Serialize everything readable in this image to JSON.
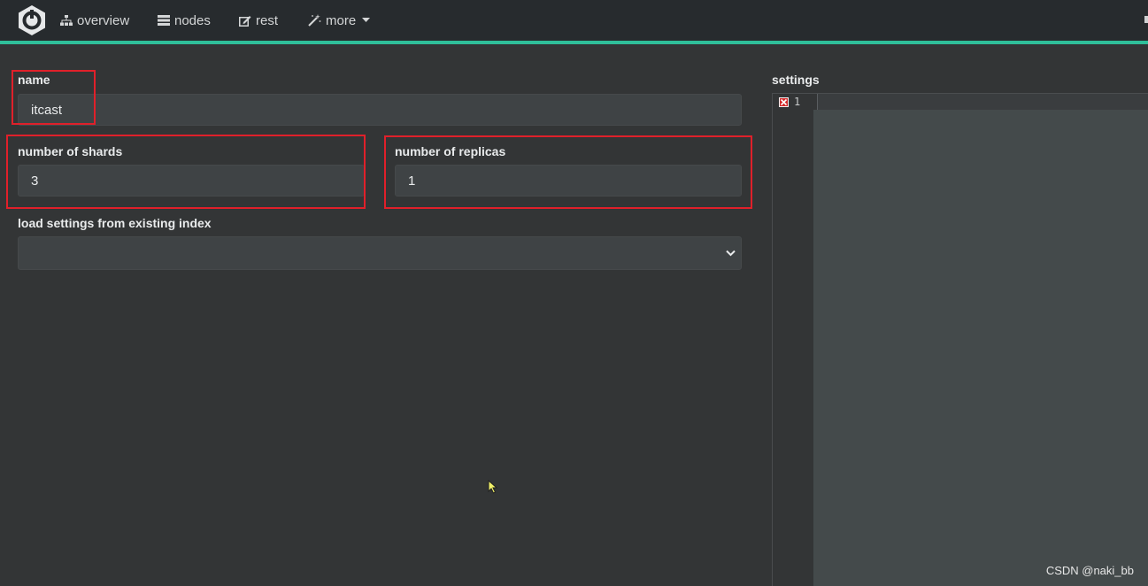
{
  "nav": {
    "items": [
      {
        "label": "overview",
        "icon": "sitemap-icon"
      },
      {
        "label": "nodes",
        "icon": "server-icon"
      },
      {
        "label": "rest",
        "icon": "edit-icon"
      },
      {
        "label": "more",
        "icon": "magic-wand-icon"
      }
    ]
  },
  "form": {
    "name_label": "name",
    "name_value": "itcast",
    "shards_label": "number of shards",
    "shards_value": "3",
    "replicas_label": "number of replicas",
    "replicas_value": "1",
    "load_label": "load settings from existing index",
    "load_value": ""
  },
  "settings": {
    "label": "settings",
    "line_number": "1"
  },
  "watermark": "CSDN @naki_bb",
  "colors": {
    "accent": "#2fbf9a",
    "highlight_box": "#e0202a",
    "background": "#333536",
    "navbar": "#272b2e"
  }
}
